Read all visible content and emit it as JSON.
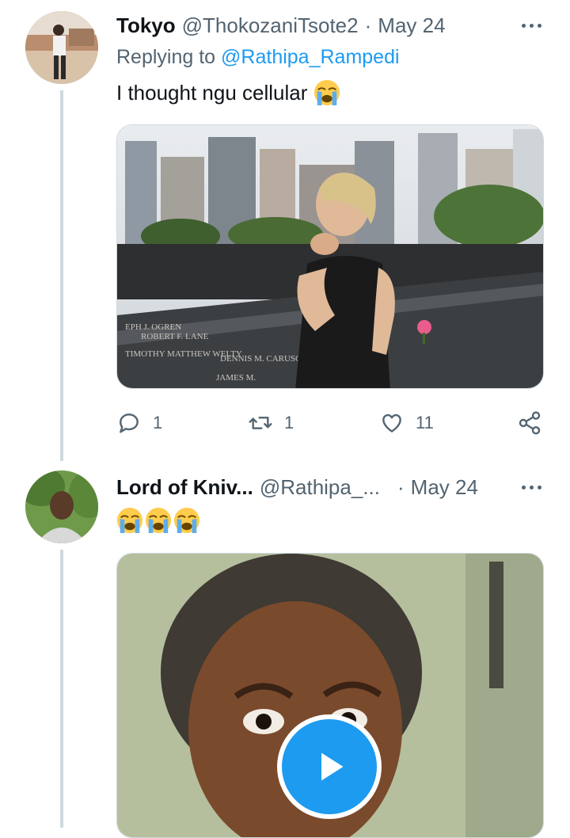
{
  "tweets": [
    {
      "name": "Tokyo",
      "handle": "@ThokozaniTsote2",
      "separator": "·",
      "date": "May 24",
      "replying_prefix": "Replying to",
      "replying_to": "@Rathipa_Rampedi",
      "text": "I thought ngu cellular",
      "emoji": "loudly-crying-face",
      "media": "photo of a woman crying beside a memorial with engraved names, city buildings behind",
      "actions": {
        "reply_count": "1",
        "retweet_count": "1",
        "like_count": "11"
      }
    },
    {
      "name": "Lord of Kniv...",
      "handle": "@Rathipa_...",
      "separator": "·",
      "date": "May 24",
      "emojis": [
        "loudly-crying-face",
        "loudly-crying-face",
        "loudly-crying-face"
      ],
      "media": "video thumbnail of a surprised man's face",
      "play_icon": "play-icon"
    }
  ],
  "colors": {
    "accent": "#1d9bf0",
    "text_primary": "#0f1419",
    "text_secondary": "#536471",
    "thread_line": "#cfd9de"
  }
}
